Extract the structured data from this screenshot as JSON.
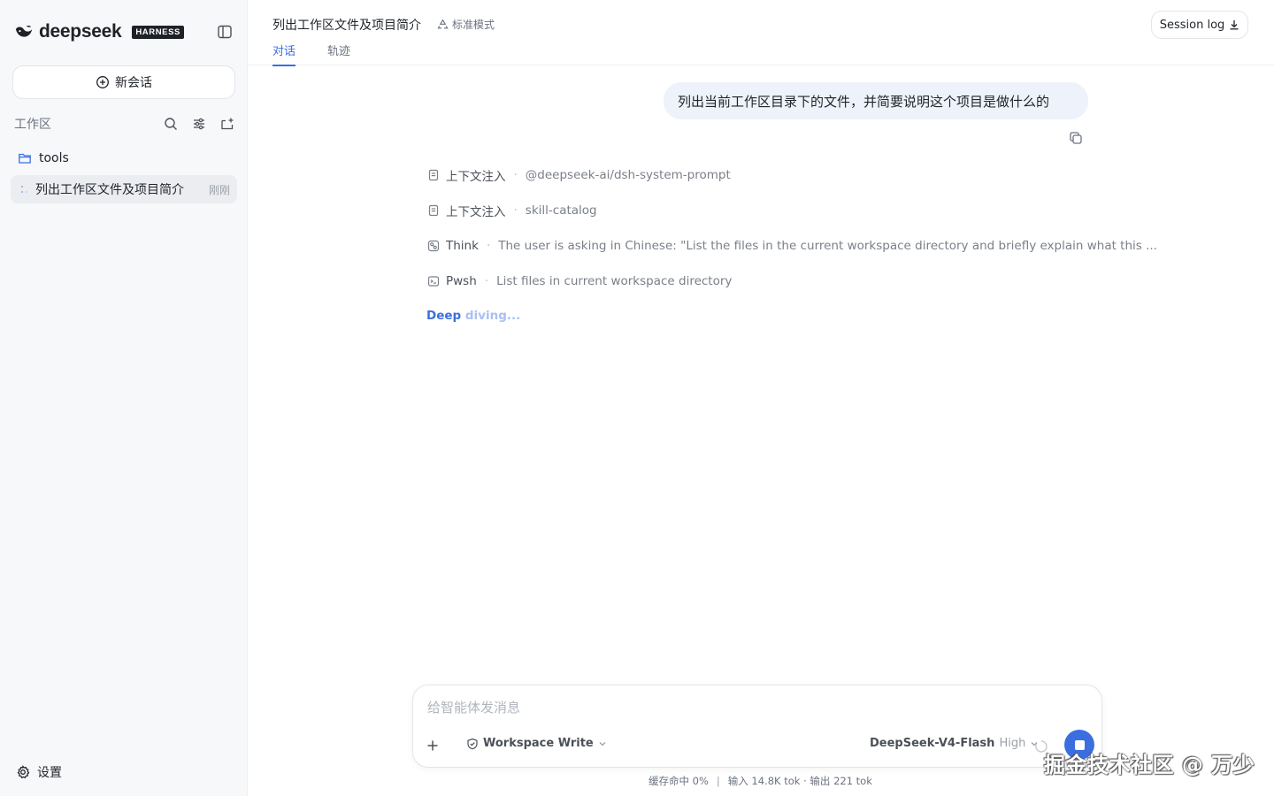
{
  "sidebar": {
    "brand": {
      "name": "deepseek",
      "badge": "HARNESS"
    },
    "new_chat_label": "新会话",
    "workspace_label": "工作区",
    "folder": {
      "name": "tools"
    },
    "session": {
      "title": "列出工作区文件及项目简介",
      "time": "刚刚"
    },
    "settings_label": "设置"
  },
  "header": {
    "title": "列出工作区文件及项目简介",
    "mode": "标准模式",
    "tabs": [
      {
        "label": "对话",
        "active": true
      },
      {
        "label": "轨迹",
        "active": false
      }
    ],
    "session_log_label": "Session log"
  },
  "conversation": {
    "user_message": "列出当前工作区目录下的文件，并简要说明这个项目是做什么的",
    "steps": [
      {
        "icon": "document-icon",
        "kind": "上下文注入",
        "detail": "@deepseek-ai/dsh-system-prompt"
      },
      {
        "icon": "document-icon",
        "kind": "上下文注入",
        "detail": "skill-catalog"
      },
      {
        "icon": "brain-icon",
        "kind": "Think",
        "detail": "The user is asking in Chinese: \"List the files in the current workspace directory and briefly explain what this ..."
      },
      {
        "icon": "terminal-icon",
        "kind": "Pwsh",
        "detail": "List files in current workspace directory"
      }
    ],
    "status": {
      "strong": "Deep ",
      "faded": "diving..."
    }
  },
  "composer": {
    "placeholder": "给智能体发消息",
    "permission": "Workspace Write",
    "model": "DeepSeek-V4-Flash",
    "effort": "High"
  },
  "stats": {
    "cache": "缓存命中 0%",
    "separator": "|",
    "tokens": "输入 14.8K tok · 输出 221 tok"
  },
  "watermark": "掘金技术社区 @ 万少",
  "colors": {
    "accent": "#3b6fe0",
    "sidebar_bg": "#f7f8fa",
    "bubble_bg": "#eef2fb"
  }
}
